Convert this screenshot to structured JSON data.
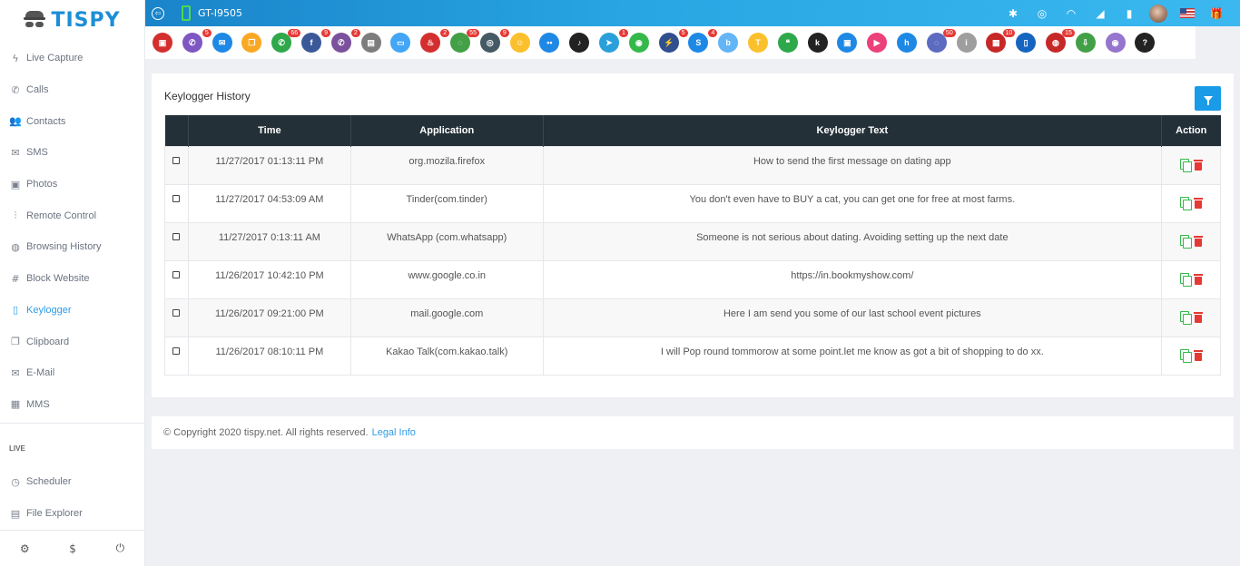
{
  "brand": {
    "name": "TISPY"
  },
  "sidebar": {
    "items": [
      {
        "label": "Live Capture",
        "icon": "bolt-icon",
        "glyph": "ϟ"
      },
      {
        "label": "Calls",
        "icon": "phone-icon",
        "glyph": "✆"
      },
      {
        "label": "Contacts",
        "icon": "users-icon",
        "glyph": "👥"
      },
      {
        "label": "SMS",
        "icon": "mail-icon",
        "glyph": "✉"
      },
      {
        "label": "Photos",
        "icon": "image-icon",
        "glyph": "▣"
      },
      {
        "label": "Remote Control",
        "icon": "sliders-icon",
        "glyph": "⫶"
      },
      {
        "label": "Browsing History",
        "icon": "globe-icon",
        "glyph": "◍"
      },
      {
        "label": "Block Website",
        "icon": "hash-icon",
        "glyph": "#"
      },
      {
        "label": "Keylogger",
        "icon": "clipboard-icon",
        "glyph": "▯",
        "active": true
      },
      {
        "label": "Clipboard",
        "icon": "copy-icon",
        "glyph": "❐"
      },
      {
        "label": "E-Mail",
        "icon": "inbox-icon",
        "glyph": "✉"
      },
      {
        "label": "MMS",
        "icon": "film-icon",
        "glyph": "▦"
      }
    ],
    "live_label": "LIVE",
    "live_items": [
      {
        "label": "Scheduler",
        "icon": "clock-icon",
        "glyph": "◷"
      },
      {
        "label": "File Explorer",
        "icon": "file-icon",
        "glyph": "▤"
      }
    ],
    "bottom": [
      {
        "name": "settings-icon",
        "glyph": "⚙"
      },
      {
        "name": "dollar-icon",
        "glyph": "$"
      },
      {
        "name": "power-icon",
        "glyph": "⏻"
      }
    ]
  },
  "topbar": {
    "device_name": "GT-I9505",
    "status_icons": [
      {
        "name": "bluetooth-icon",
        "glyph": "✱"
      },
      {
        "name": "location-icon",
        "glyph": "◎"
      },
      {
        "name": "wifi-icon",
        "glyph": "◠"
      },
      {
        "name": "signal-icon",
        "glyph": "◢"
      },
      {
        "name": "battery-icon",
        "glyph": "▮"
      }
    ],
    "gift_glyph": "🎁"
  },
  "apps": [
    {
      "name": "camera-app-icon",
      "color": "#d32f2f",
      "glyph": "▣",
      "badge": ""
    },
    {
      "name": "phone-app-icon",
      "color": "#7e57c2",
      "glyph": "✆",
      "badge": "5"
    },
    {
      "name": "email-app-icon",
      "color": "#1e88e5",
      "glyph": "✉",
      "badge": ""
    },
    {
      "name": "clipboard-app-icon",
      "color": "#f9a825",
      "glyph": "❐",
      "badge": ""
    },
    {
      "name": "whatsapp-app-icon",
      "color": "#2ea84a",
      "glyph": "✆",
      "badge": "66"
    },
    {
      "name": "facebook-app-icon",
      "color": "#3b5998",
      "glyph": "f",
      "badge": "9"
    },
    {
      "name": "viber-app-icon",
      "color": "#7b519d",
      "glyph": "✆",
      "badge": "2"
    },
    {
      "name": "bag-app-icon",
      "color": "#7d7d7d",
      "glyph": "▤",
      "badge": ""
    },
    {
      "name": "screen-app-icon",
      "color": "#42a5f5",
      "glyph": "▭",
      "badge": ""
    },
    {
      "name": "tinder-app-icon",
      "color": "#d32f2f",
      "glyph": "♨",
      "badge": "2"
    },
    {
      "name": "wechat-app-icon",
      "color": "#43a047",
      "glyph": "◌",
      "badge": "55"
    },
    {
      "name": "instagram-app-icon",
      "color": "#455a64",
      "glyph": "◎",
      "badge": "9"
    },
    {
      "name": "snapchat-app-icon",
      "color": "#fbc02d",
      "glyph": "☺",
      "badge": ""
    },
    {
      "name": "flickr-app-icon",
      "color": "#1e88e5",
      "glyph": "••",
      "badge": ""
    },
    {
      "name": "tiktok-app-icon",
      "color": "#222222",
      "glyph": "♪",
      "badge": ""
    },
    {
      "name": "telegram-app-icon",
      "color": "#29a0da",
      "glyph": "➤",
      "badge": "1"
    },
    {
      "name": "line-app-icon",
      "color": "#35b84a",
      "glyph": "◉",
      "badge": ""
    },
    {
      "name": "messenger-app-icon",
      "color": "#2f4f8f",
      "glyph": "⚡",
      "badge": "5"
    },
    {
      "name": "skype-app-icon",
      "color": "#1e88e5",
      "glyph": "S",
      "badge": "4"
    },
    {
      "name": "bip-app-icon",
      "color": "#64b5f6",
      "glyph": "b",
      "badge": ""
    },
    {
      "name": "talk-app-icon",
      "color": "#fbc02d",
      "glyph": "T",
      "badge": ""
    },
    {
      "name": "hangouts-app-icon",
      "color": "#2ea84a",
      "glyph": "❝",
      "badge": ""
    },
    {
      "name": "kik-app-icon",
      "color": "#222222",
      "glyph": "k",
      "badge": ""
    },
    {
      "name": "gallery-app-icon",
      "color": "#1e88e5",
      "glyph": "▣",
      "badge": ""
    },
    {
      "name": "video-app-icon",
      "color": "#ec407a",
      "glyph": "▶",
      "badge": ""
    },
    {
      "name": "hike-app-icon",
      "color": "#1e88e5",
      "glyph": "h",
      "badge": ""
    },
    {
      "name": "signal-app-icon",
      "color": "#5c6bc0",
      "glyph": "◌",
      "badge": "50"
    },
    {
      "name": "imo-app-icon",
      "color": "#9e9e9e",
      "glyph": "i",
      "badge": ""
    },
    {
      "name": "photos-app-icon",
      "color": "#c62828",
      "glyph": "▦",
      "badge": "10"
    },
    {
      "name": "device-app-icon",
      "color": "#1565c0",
      "glyph": "▯",
      "badge": ""
    },
    {
      "name": "browser-app-icon",
      "color": "#c62828",
      "glyph": "◍",
      "badge": "15"
    },
    {
      "name": "download-app-icon",
      "color": "#43a047",
      "glyph": "⇩",
      "badge": ""
    },
    {
      "name": "location-app-icon",
      "color": "#9575cd",
      "glyph": "◉",
      "badge": ""
    },
    {
      "name": "help-app-icon",
      "color": "#222222",
      "glyph": "?",
      "badge": ""
    }
  ],
  "panel": {
    "title": "Keylogger History",
    "columns": [
      "",
      "Time",
      "Application",
      "Keylogger Text",
      "Action"
    ],
    "rows": [
      {
        "time": "11/27/2017 01:13:11 PM",
        "app": "org.mozila.firefox",
        "text": "How to send the first message on dating app"
      },
      {
        "time": "11/27/2017 04:53:09 AM",
        "app": "Tinder(com.tinder)",
        "text": "You don't even have to BUY a cat, you can get one for free at most farms."
      },
      {
        "time": "11/27/2017 0:13:11 AM",
        "app": "WhatsApp (com.whatsapp)",
        "text": "Someone is not serious about dating. Avoiding setting up the next date"
      },
      {
        "time": "11/26/2017 10:42:10 PM",
        "app": "www.google.co.in",
        "text": "https://in.bookmyshow.com/"
      },
      {
        "time": "11/26/2017 09:21:00 PM",
        "app": "mail.google.com",
        "text": "Here I am send you some of our last school event pictures"
      },
      {
        "time": "11/26/2017 08:10:11 PM",
        "app": "Kakao Talk(com.kakao.talk)",
        "text": "I will Pop round tommorow at some point.let me know as got a bit of shopping to do xx."
      }
    ]
  },
  "footer": {
    "copyright": "© Copyright 2020 tispy.net. All rights reserved.",
    "link": "Legal Info"
  }
}
